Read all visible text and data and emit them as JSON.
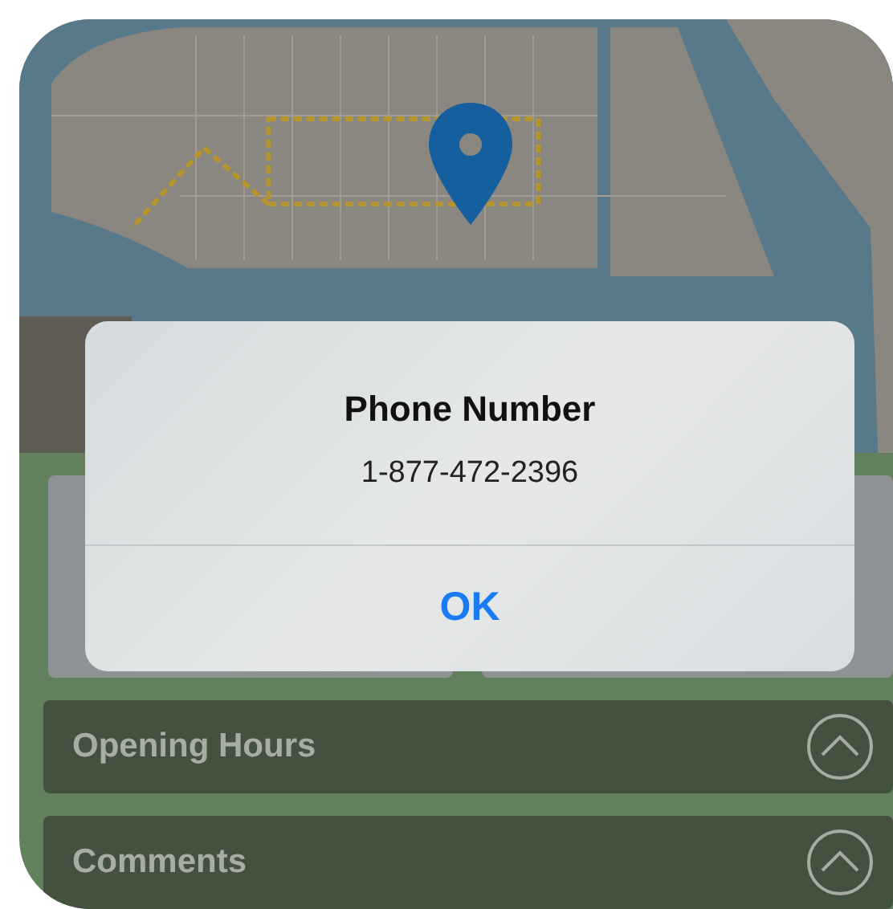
{
  "alert": {
    "title": "Phone Number",
    "message": "1-877-472-2396",
    "buttons": [
      {
        "label": "OK"
      }
    ]
  },
  "sections": [
    {
      "title": "Opening Hours"
    },
    {
      "title": "Comments"
    }
  ]
}
